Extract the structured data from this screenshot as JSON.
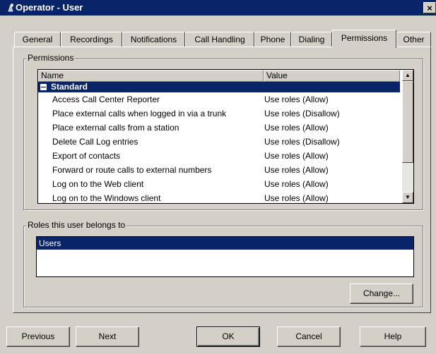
{
  "window": {
    "title": "Operator - User",
    "close_glyph": "×"
  },
  "tabs": [
    {
      "label": "General"
    },
    {
      "label": "Recordings"
    },
    {
      "label": "Notifications"
    },
    {
      "label": "Call Handling"
    },
    {
      "label": "Phone"
    },
    {
      "label": "Dialing"
    },
    {
      "label": "Permissions"
    },
    {
      "label": "Other"
    }
  ],
  "permissions": {
    "group_label": "Permissions",
    "columns": {
      "name": "Name",
      "value": "Value"
    },
    "group_row": "Standard",
    "rows": [
      {
        "name": "Access Call Center Reporter",
        "value": "Use roles (Allow)"
      },
      {
        "name": "Place external calls when logged in via a trunk",
        "value": "Use roles (Disallow)"
      },
      {
        "name": "Place external calls from a station",
        "value": "Use roles (Allow)"
      },
      {
        "name": "Delete Call Log entries",
        "value": "Use roles (Disallow)"
      },
      {
        "name": "Export of contacts",
        "value": "Use roles (Allow)"
      },
      {
        "name": "Forward or route calls to external numbers",
        "value": "Use roles (Allow)"
      },
      {
        "name": "Log on to the Web client",
        "value": "Use roles (Allow)"
      },
      {
        "name": "Log on to the Windows client",
        "value": "Use roles (Allow)"
      }
    ]
  },
  "roles": {
    "group_label": "Roles this user belongs to",
    "items": [
      "Users"
    ],
    "change_button": "Change..."
  },
  "buttons": {
    "previous": "Previous",
    "next": "Next",
    "ok": "OK",
    "cancel": "Cancel",
    "help": "Help"
  },
  "colors": {
    "titlebar": "#0a246a",
    "face": "#d4d0c8",
    "selection": "#0a246a"
  }
}
